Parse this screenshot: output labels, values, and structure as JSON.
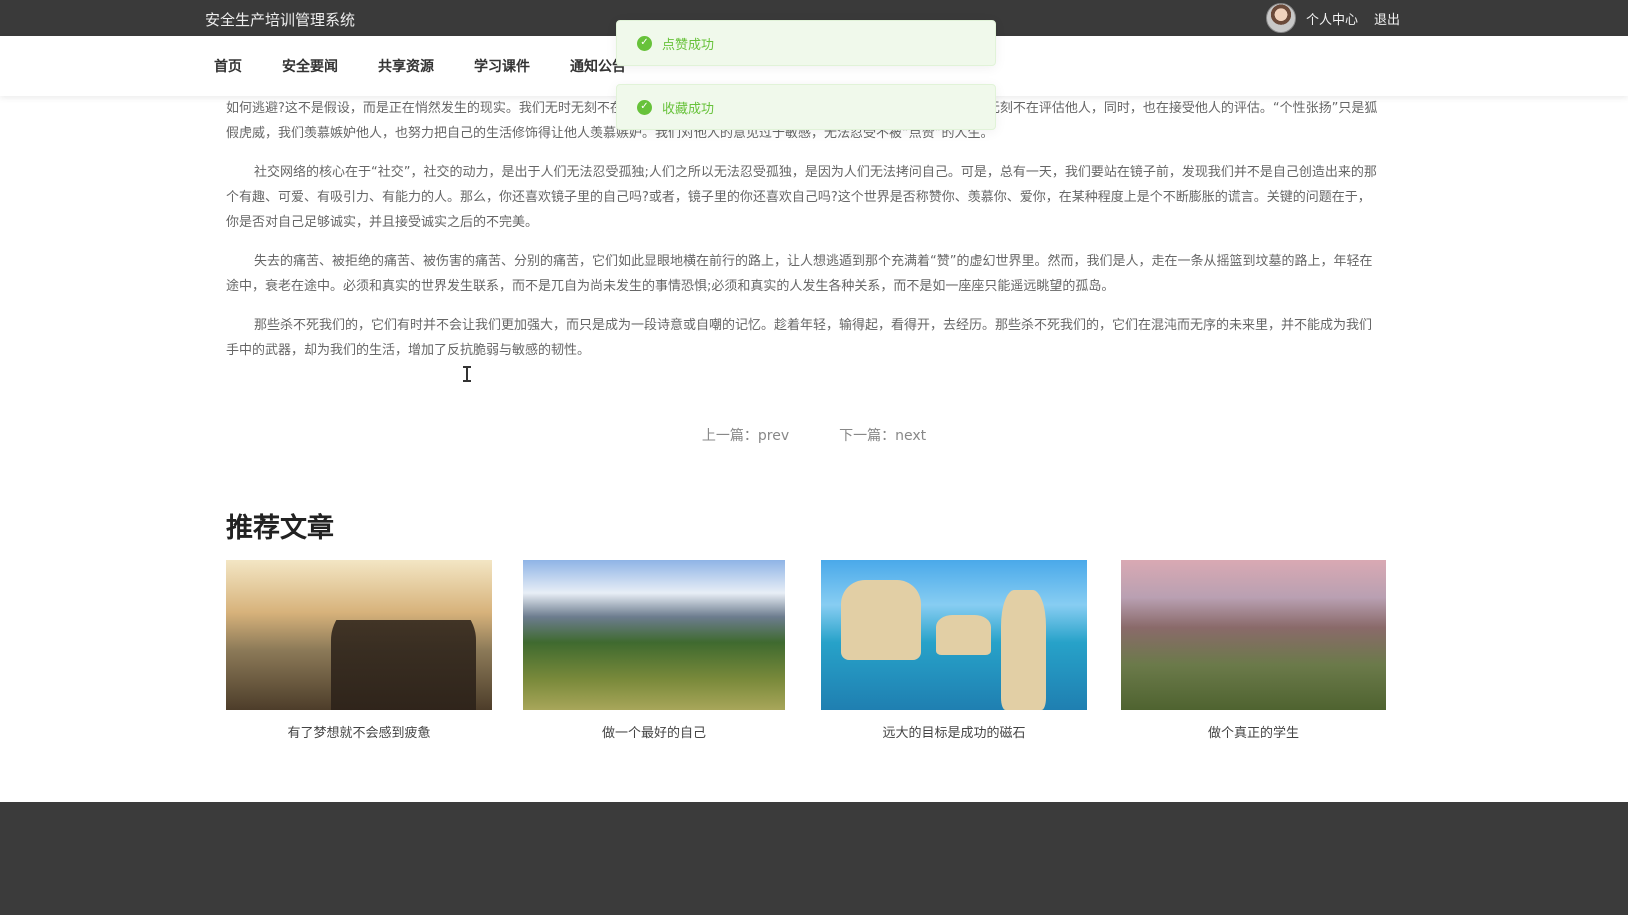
{
  "header": {
    "site_title": "安全生产培训管理系统",
    "user_center": "个人中心",
    "logout": "退出"
  },
  "nav": {
    "items": [
      "首页",
      "安全要闻",
      "共享资源",
      "学习课件",
      "通知公告"
    ]
  },
  "toasts": [
    {
      "text": "点赞成功"
    },
    {
      "text": "收藏成功"
    }
  ],
  "article": {
    "paragraphs": [
      "如何逃避?这不是假设，而是正在悄然发生的现实。我们无时无刻不在评估他人，同时，也在同样的平台上窥探他人的生活。我们无时无刻不在评估他人，同时，也在接受他人的评估。“个性张扬”只是狐假虎威，我们羡慕嫉妒他人，也努力把自己的生活修饰得让他人羡慕嫉妒。我们对他人的意见过于敏感，无法忍受不被“点赞”的人生。",
      "社交网络的核心在于“社交”，社交的动力，是出于人们无法忍受孤独;人们之所以无法忍受孤独，是因为人们无法拷问自己。可是，总有一天，我们要站在镜子前，发现我们并不是自己创造出来的那个有趣、可爱、有吸引力、有能力的人。那么，你还喜欢镜子里的自己吗?或者，镜子里的你还喜欢自己吗?这个世界是否称赞你、羡慕你、爱你，在某种程度上是个不断膨胀的谎言。关键的问题在于，你是否对自己足够诚实，并且接受诚实之后的不完美。",
      "失去的痛苦、被拒绝的痛苦、被伤害的痛苦、分别的痛苦，它们如此显眼地横在前行的路上，让人想逃遁到那个充满着“赞”的虚幻世界里。然而，我们是人，走在一条从摇篮到坟墓的路上，年轻在途中，衰老在途中。必须和真实的世界发生联系，而不是兀自为尚未发生的事情恐惧;必须和真实的人发生各种关系，而不是如一座座只能遥远眺望的孤岛。",
      "那些杀不死我们的，它们有时并不会让我们更加强大，而只是成为一段诗意或自嘲的记忆。趁着年轻，输得起，看得开，去经历。那些杀不死我们的，它们在混沌而无序的未来里，并不能成为我们手中的武器，却为我们的生活，增加了反抗脆弱与敏感的韧性。"
    ]
  },
  "pager": {
    "prev": "上一篇：prev",
    "next": "下一篇：next"
  },
  "recommend": {
    "title": "推荐文章",
    "items": [
      {
        "caption": "有了梦想就不会感到疲惫"
      },
      {
        "caption": "做一个最好的自己"
      },
      {
        "caption": "远大的目标是成功的磁石"
      },
      {
        "caption": "做个真正的学生"
      }
    ]
  },
  "colors": {
    "topbar": "#3a3a3a",
    "toast_bg": "#f0f9eb",
    "toast_text": "#67c23a",
    "footer": "#3b3b3b"
  }
}
